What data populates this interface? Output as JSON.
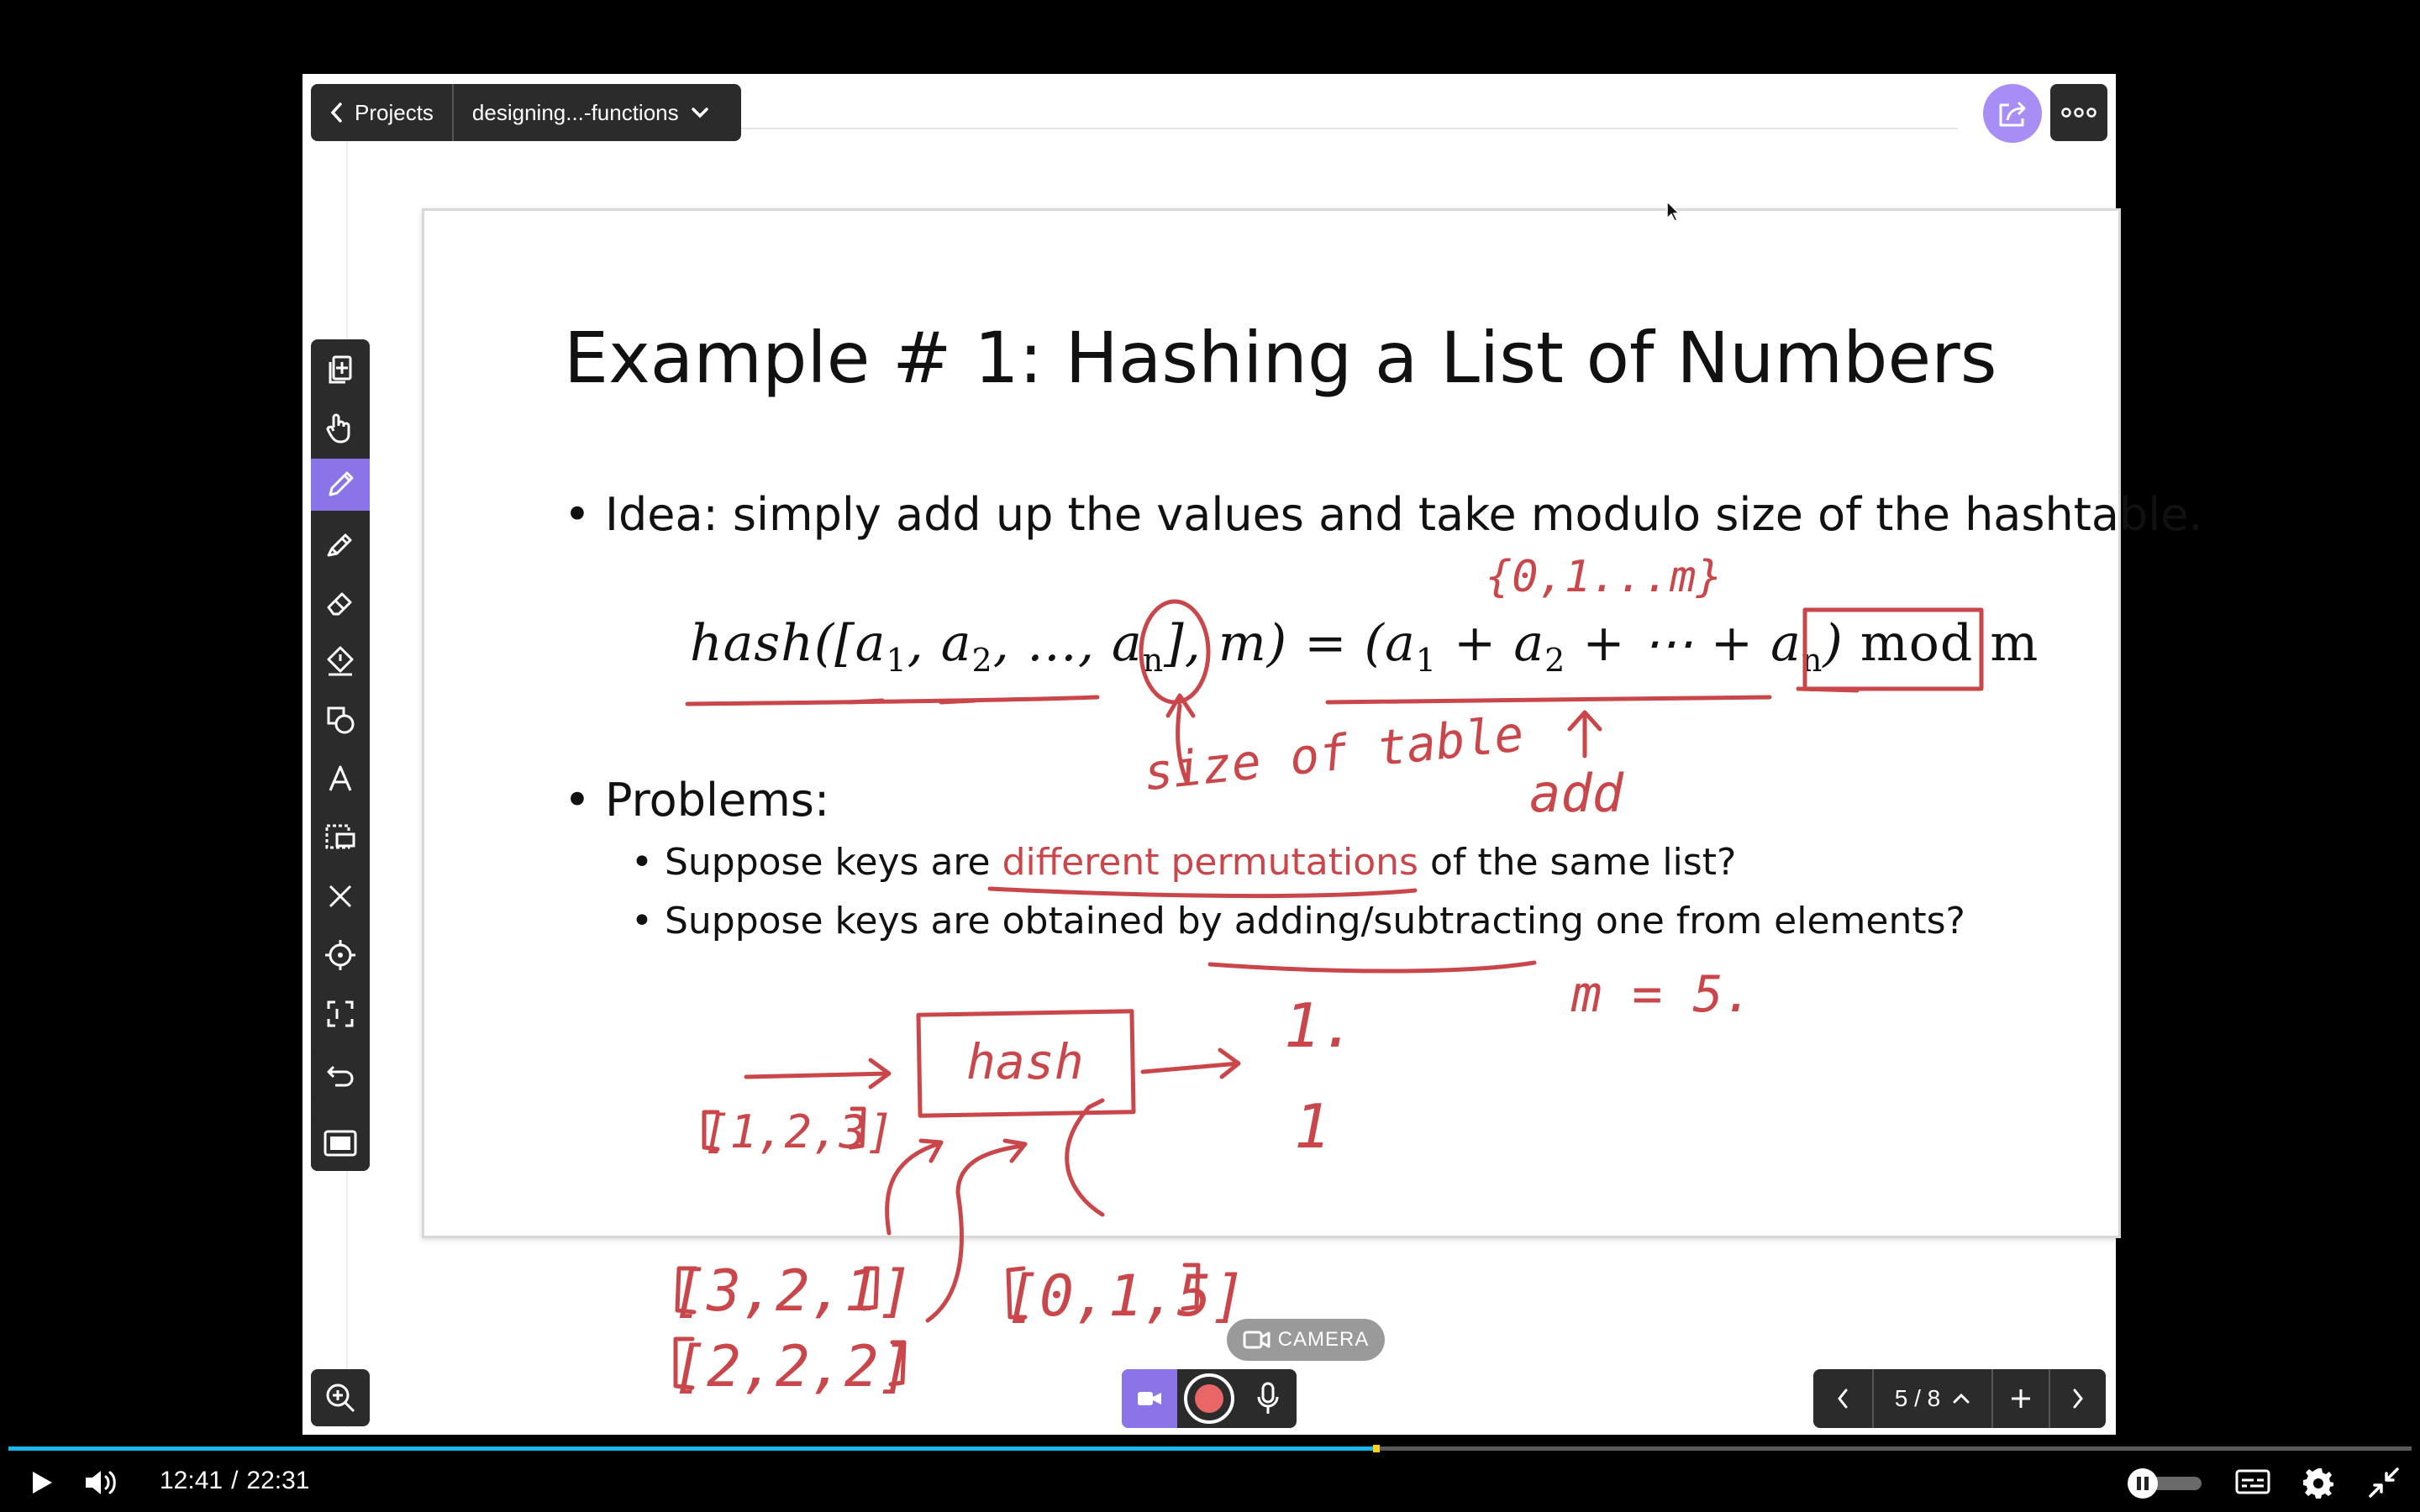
{
  "header": {
    "back_label": "Projects",
    "project_name": "designing...-functions"
  },
  "slide": {
    "title": "Example # 1: Hashing a List of Numbers",
    "bullet_idea": "Idea: simply add up the values and take modulo size of the hashtable.",
    "formula": {
      "lhs": "hash([a",
      "sub1": "1",
      "sep1": ", a",
      "sub2": "2",
      "sep2": ", …, a",
      "subn": "n",
      "mid": "], m) = (a",
      "sub3": "1",
      "plus1": " + a",
      "sub4": "2",
      "plus2": " + ⋯ + a",
      "sub5": "n",
      "close": ")",
      "mod": "mod m"
    },
    "bullet_problems": "Problems:",
    "sub_bullet_1_pre": "Suppose keys are ",
    "sub_bullet_1_highlight": "different permutations",
    "sub_bullet_1_post": " of the same list?",
    "sub_bullet_2": "Suppose keys are obtained by adding/subtracting one from elements?"
  },
  "annotations": {
    "set_note": "{0,1...m}",
    "size_note": "size of table",
    "add_note": "add",
    "m_note": "m = 5.",
    "hash_box": "hash",
    "list_a": "[1,2,3]",
    "list_b": "[3,2,1]",
    "list_c": "[2,2,2]",
    "list_d": "[0,1,5]",
    "out_1": "1.",
    "out_2": "1"
  },
  "camera": {
    "label": "CAMERA"
  },
  "pager": {
    "page_display": "5 / 8"
  },
  "player": {
    "current_time": "12:41",
    "separator": "/",
    "duration": "22:31",
    "progress": 0.568
  },
  "colors": {
    "accent_purple": "#8b74e8",
    "ink_red": "#c9474b",
    "progress_blue": "#1ab7ea",
    "toolbar_dark": "#2b2b2b"
  },
  "toolbar": {
    "tools": [
      "add-page-icon",
      "hand-icon",
      "pen-icon",
      "marker-icon",
      "eraser-icon",
      "fill-icon",
      "shapes-icon",
      "text-icon",
      "select-icon",
      "close-icon",
      "laser-icon",
      "crop-icon"
    ],
    "active_tool": "pen-icon"
  }
}
